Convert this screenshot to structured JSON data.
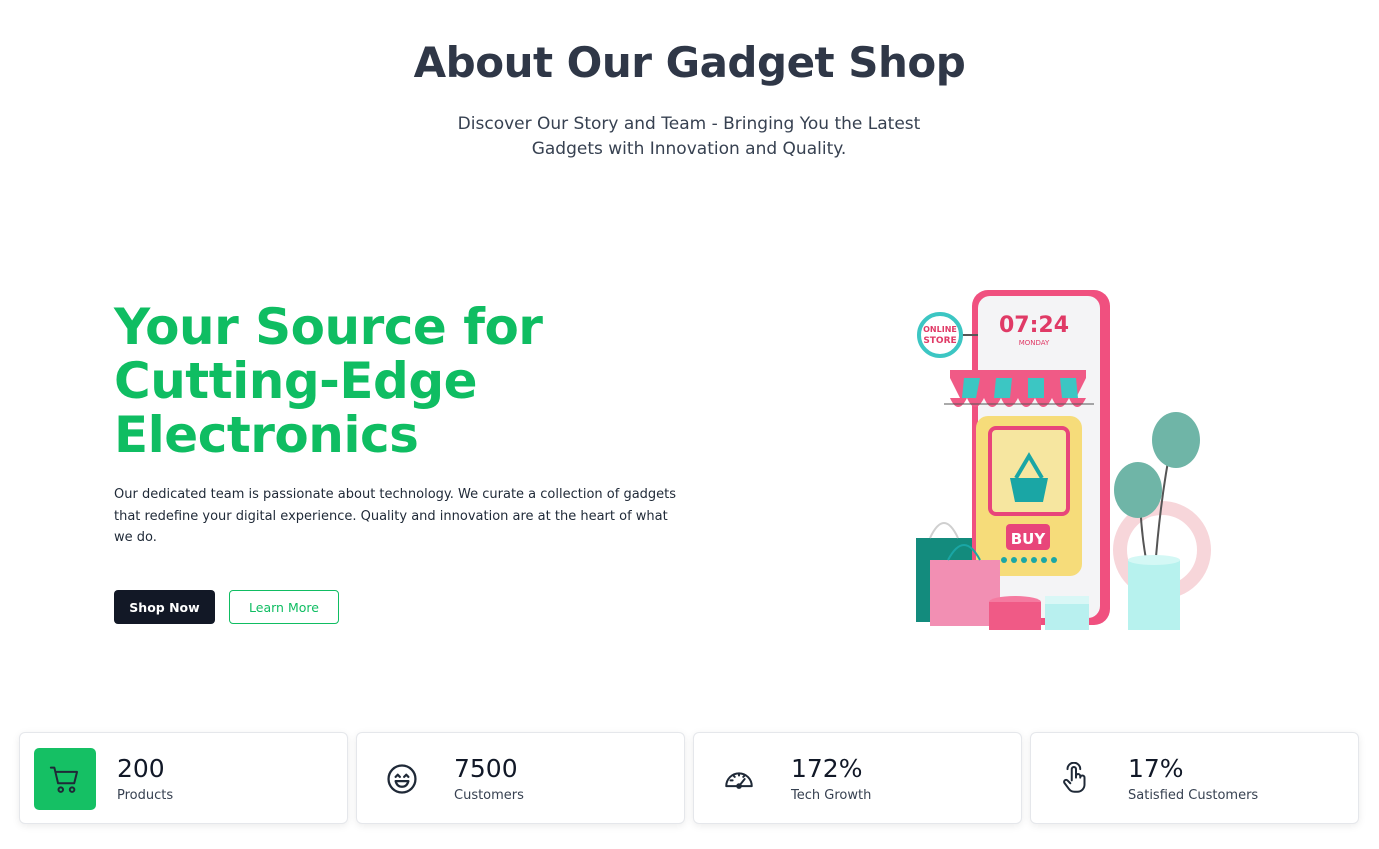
{
  "header": {
    "title": "About Our Gadget Shop",
    "subtitle": "Discover Our Story and Team - Bringing You the Latest Gadgets with Innovation and Quality."
  },
  "hero": {
    "heading": "Your Source for Cutting-Edge Electronics",
    "description": "Our dedicated team is passionate about technology. We curate a collection of gadgets that redefine your digital experience. Quality and innovation are at the heart of what we do.",
    "primary_button": "Shop Now",
    "secondary_button": "Learn More"
  },
  "illustration": {
    "sign_line1": "ONLINE",
    "sign_line2": "STORE",
    "time": "07:24",
    "day": "MONDAY",
    "buy_label": "BUY"
  },
  "stats": [
    {
      "value": "200",
      "label": "Products",
      "icon": "cart-icon"
    },
    {
      "value": "7500",
      "label": "Customers",
      "icon": "smile-icon"
    },
    {
      "value": "172%",
      "label": "Tech Growth",
      "icon": "speedometer-icon"
    },
    {
      "value": "17%",
      "label": "Satisfied Customers",
      "icon": "hand-pointer-icon"
    }
  ],
  "colors": {
    "accent": "#0fbd62",
    "dark_button": "#121826",
    "title": "#2f3747"
  }
}
